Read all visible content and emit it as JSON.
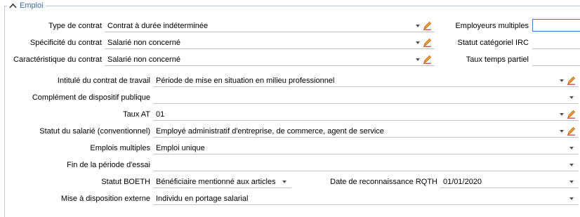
{
  "group": {
    "title": "Emploi"
  },
  "left_fields": [
    {
      "label": "Type de contrat",
      "value": "Contrat à durée indéterminée"
    },
    {
      "label": "Spécificité du contrat",
      "value": "Salarié non concerné"
    },
    {
      "label": "Caractéristique du contrat",
      "value": "Salarié non concerné"
    }
  ],
  "right_fields": [
    {
      "label": "Employeurs multiples",
      "value": ""
    },
    {
      "label": "Statut catégoriel IRC",
      "value": ""
    },
    {
      "label": "Taux temps partiel",
      "value": ""
    }
  ],
  "rows": [
    {
      "label": "Intitulé du contrat de travail",
      "value": "Période de mise en situation en milieu professionnel"
    },
    {
      "label": "Complément de dispositif publique",
      "value": ""
    },
    {
      "label": "Taux AT",
      "value": "01"
    },
    {
      "label": "Statut du salarié (conventionnel)",
      "value": "Employé administratif d'entreprise, de commerce, agent de service"
    },
    {
      "label": "Emplois multiples",
      "value": "Emploi unique"
    },
    {
      "label": "Fin de la période d'essai",
      "value": ""
    },
    {
      "label": "Statut BOETH",
      "value": "Bénéficiaire mentionné aux articles L"
    },
    {
      "label": "Mise à disposition externe",
      "value": "Individu en portage salarial"
    }
  ],
  "rqth": {
    "label": "Date de reconnaissance RQTH",
    "value": "01/01/2020"
  },
  "colors": {
    "accent": "#3a6ea5",
    "pencil": "#e07b00"
  },
  "icons": [
    "chevron-up-icon",
    "dropdown-arrow-icon",
    "edit-pencil-icon"
  ]
}
